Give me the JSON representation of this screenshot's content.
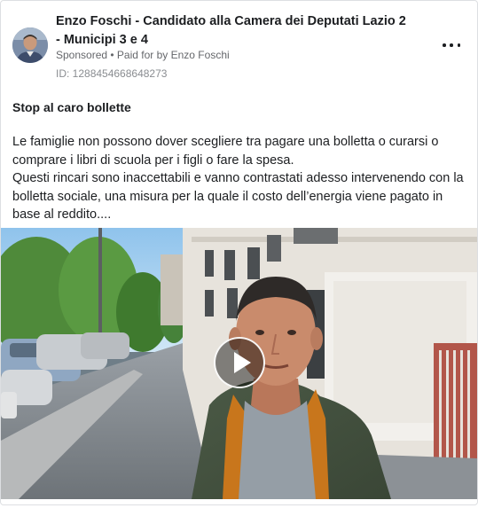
{
  "ad": {
    "advertiser": "Enzo Foschi - Candidato alla Camera dei Deputati Lazio 2 - Municipi 3 e 4",
    "sponsored": "Sponsored",
    "paid_for_by": " • Paid for by ",
    "payer": "Enzo Foschi",
    "id_label": "ID: 1288454668648273",
    "title": "Stop al caro bollette",
    "paragraph1": "Le famiglie non possono dover scegliere tra pagare una bolletta o curarsi o comprare i libri di scuola per i figli o fare la spesa.",
    "paragraph2": "Questi rincari sono inaccettabili e vanno contrastati adesso intervenendo con la bolletta sociale, una misura per la quale il costo dell’energia viene pagato in base al reddito...."
  },
  "icons": {
    "more": "more-options-icon",
    "play": "play-icon"
  },
  "colors": {
    "text": "#1c1e21",
    "secondary": "#65676b",
    "border": "#dddfe2"
  }
}
